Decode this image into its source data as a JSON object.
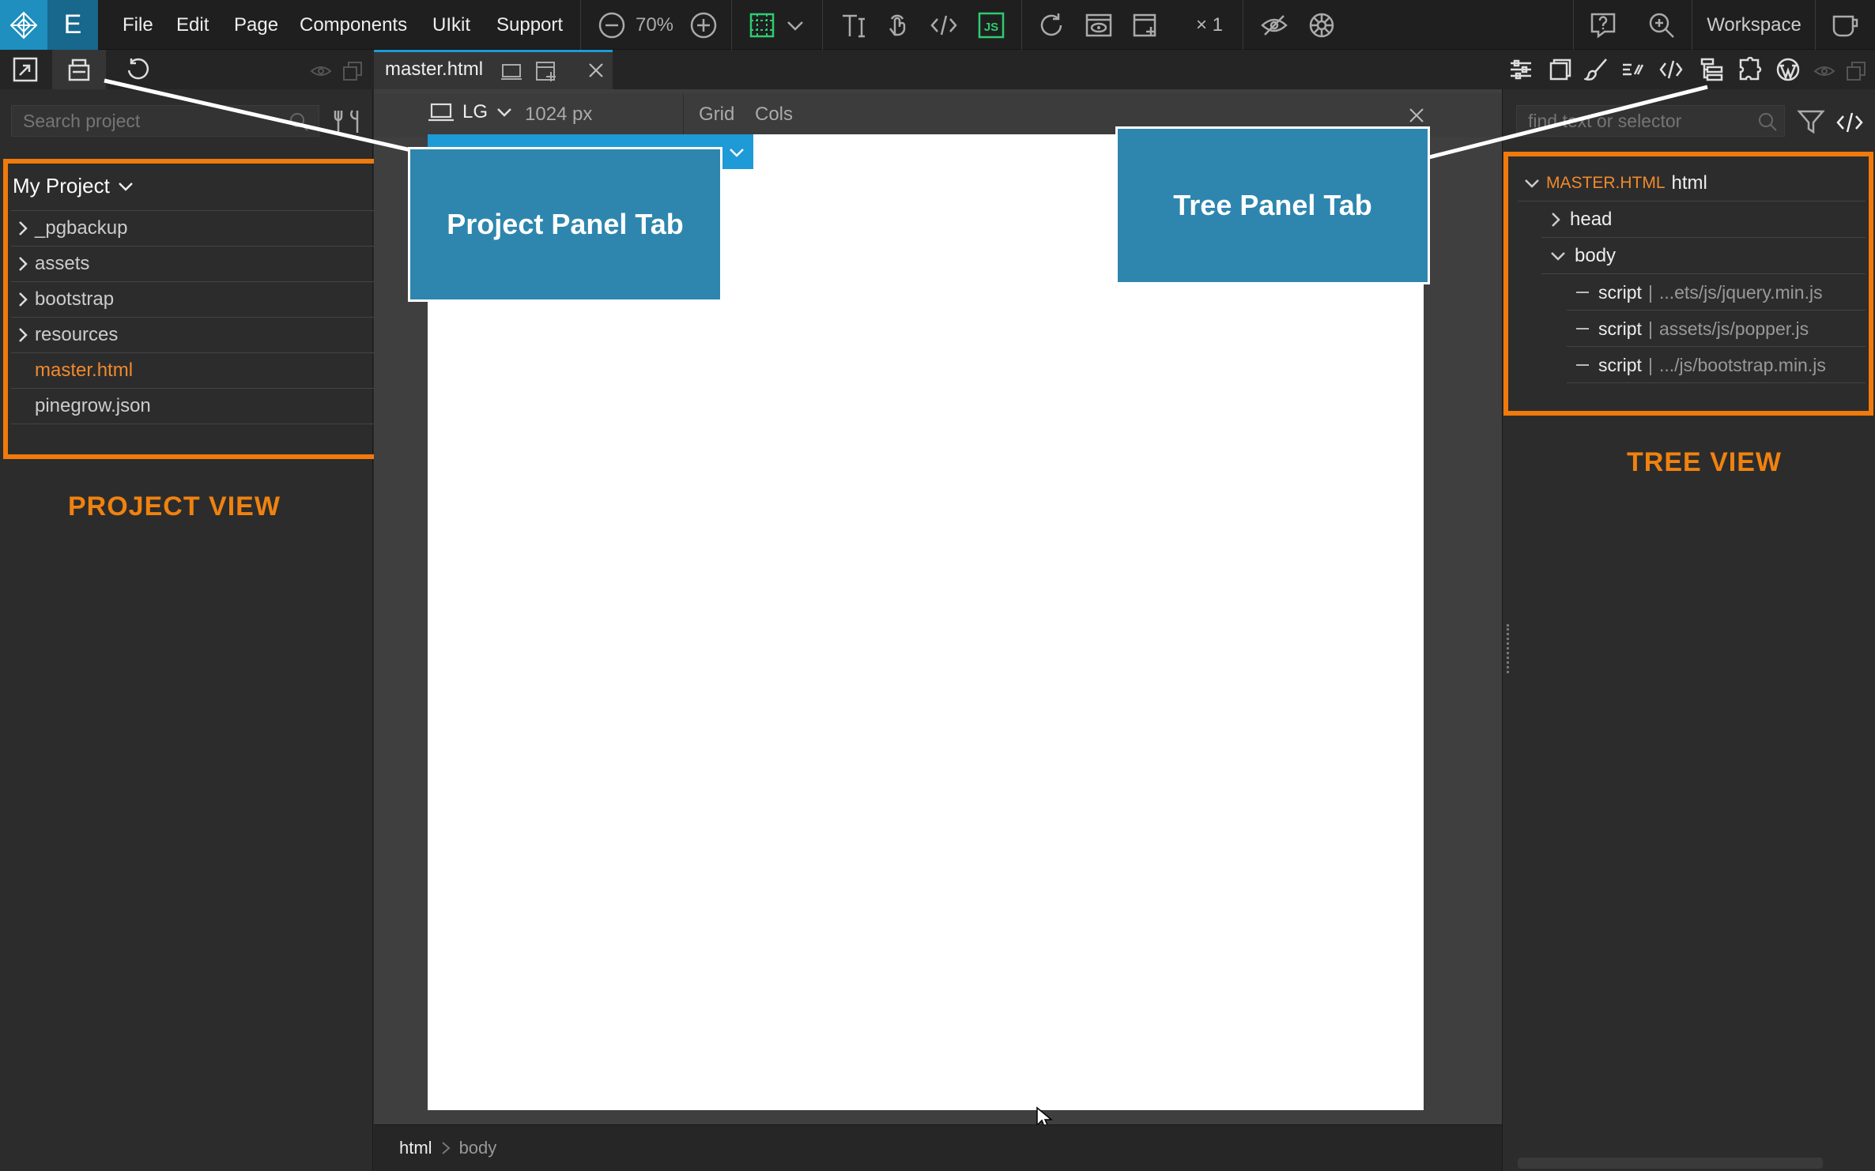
{
  "menubar": {
    "edit_mode_label": "E",
    "menus": [
      "File",
      "Edit",
      "Page",
      "Components",
      "UIkit",
      "Support"
    ],
    "zoom": "70%",
    "multiplier": "× 1",
    "workspace_label": "Workspace"
  },
  "document_tab": {
    "filename": "master.html"
  },
  "page_toolbar": {
    "breakpoint": "LG",
    "width": "1024 px",
    "grid_label": "Grid",
    "cols_label": "Cols"
  },
  "project_panel": {
    "search_placeholder": "Search project",
    "project_name": "My Project",
    "items": [
      {
        "label": "_pgbackup",
        "type": "folder"
      },
      {
        "label": "assets",
        "type": "folder"
      },
      {
        "label": "bootstrap",
        "type": "folder"
      },
      {
        "label": "resources",
        "type": "folder"
      },
      {
        "label": "master.html",
        "type": "file",
        "active": true
      },
      {
        "label": "pinegrow.json",
        "type": "file"
      }
    ],
    "view_label": "PROJECT VIEW"
  },
  "tree_panel": {
    "search_placeholder": "find text or selector",
    "root_file": "MASTER.HTML",
    "root_tag": "html",
    "nodes": [
      {
        "tag": "head"
      },
      {
        "tag": "body"
      },
      {
        "tag": "script",
        "sep": "|",
        "detail": "...ets/js/jquery.min.js"
      },
      {
        "tag": "script",
        "sep": "|",
        "detail": "assets/js/popper.js"
      },
      {
        "tag": "script",
        "sep": "|",
        "detail": ".../js/bootstrap.min.js"
      }
    ],
    "view_label": "TREE VIEW"
  },
  "callouts": {
    "project_tab": "Project Panel Tab",
    "tree_tab": "Tree Panel Tab"
  },
  "breadcrumb": {
    "items": [
      "html",
      "body"
    ]
  },
  "colors": {
    "accent": "#1e8fbe",
    "highlight": "#f07a0b",
    "callout": "#2e86ae",
    "active_file": "#f08a2c"
  }
}
